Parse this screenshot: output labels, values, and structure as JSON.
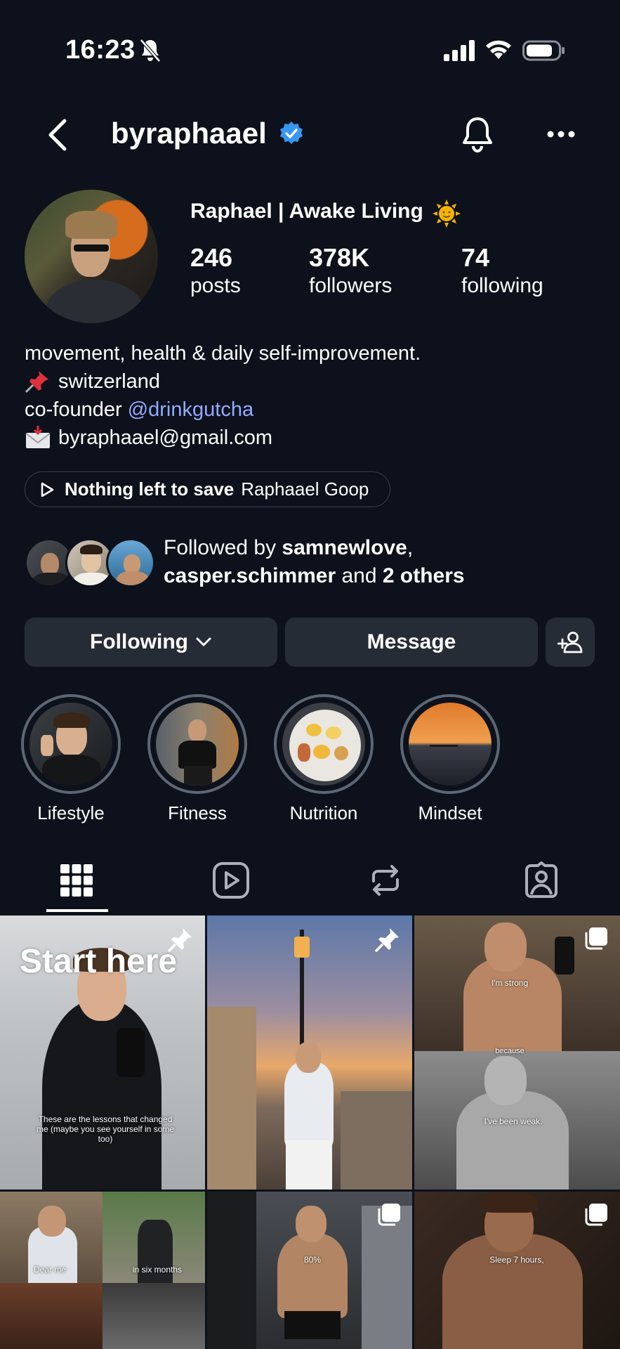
{
  "status_bar": {
    "time": "16:23"
  },
  "header": {
    "username": "byraphaael"
  },
  "profile": {
    "full_name": "Raphael | Awake Living",
    "stats": [
      {
        "value": "246",
        "label": "posts"
      },
      {
        "value": "378K",
        "label": "followers"
      },
      {
        "value": "74",
        "label": "following"
      }
    ]
  },
  "bio": {
    "line1": "movement, health & daily self-improvement.",
    "line2": "switzerland",
    "line3_prefix": "co-founder ",
    "line3_link": "@drinkgutcha",
    "line4": "byraphaael@gmail.com"
  },
  "music": {
    "song": "Nothing left to save",
    "artist": "Raphaael Goop"
  },
  "followed_by": {
    "prefix": "Followed by ",
    "user1": "samnewlove",
    "sep": ",",
    "user2": "casper.schimmer",
    "and": " and ",
    "others": "2 others"
  },
  "actions": {
    "following": "Following",
    "message": "Message"
  },
  "highlights": [
    {
      "label": "Lifestyle"
    },
    {
      "label": "Fitness"
    },
    {
      "label": "Nutrition"
    },
    {
      "label": "Mindset"
    }
  ],
  "posts": {
    "p1_title": "Start here",
    "p1_caption": "These are the lessons that changed me (maybe you see yourself in some too)",
    "p3_caption_a": "I'm strong",
    "p3_caption_b": "because",
    "p3_caption_c": "I've been weak.",
    "p4_caption_a": "Dear me",
    "p4_caption_b": "in six months",
    "p5_caption": "80%",
    "p6_caption": "Sleep 7 hours,"
  },
  "colors": {
    "background": "#0c111b",
    "button": "#262c36",
    "link": "#94aaff",
    "verified": "#3897f0"
  }
}
